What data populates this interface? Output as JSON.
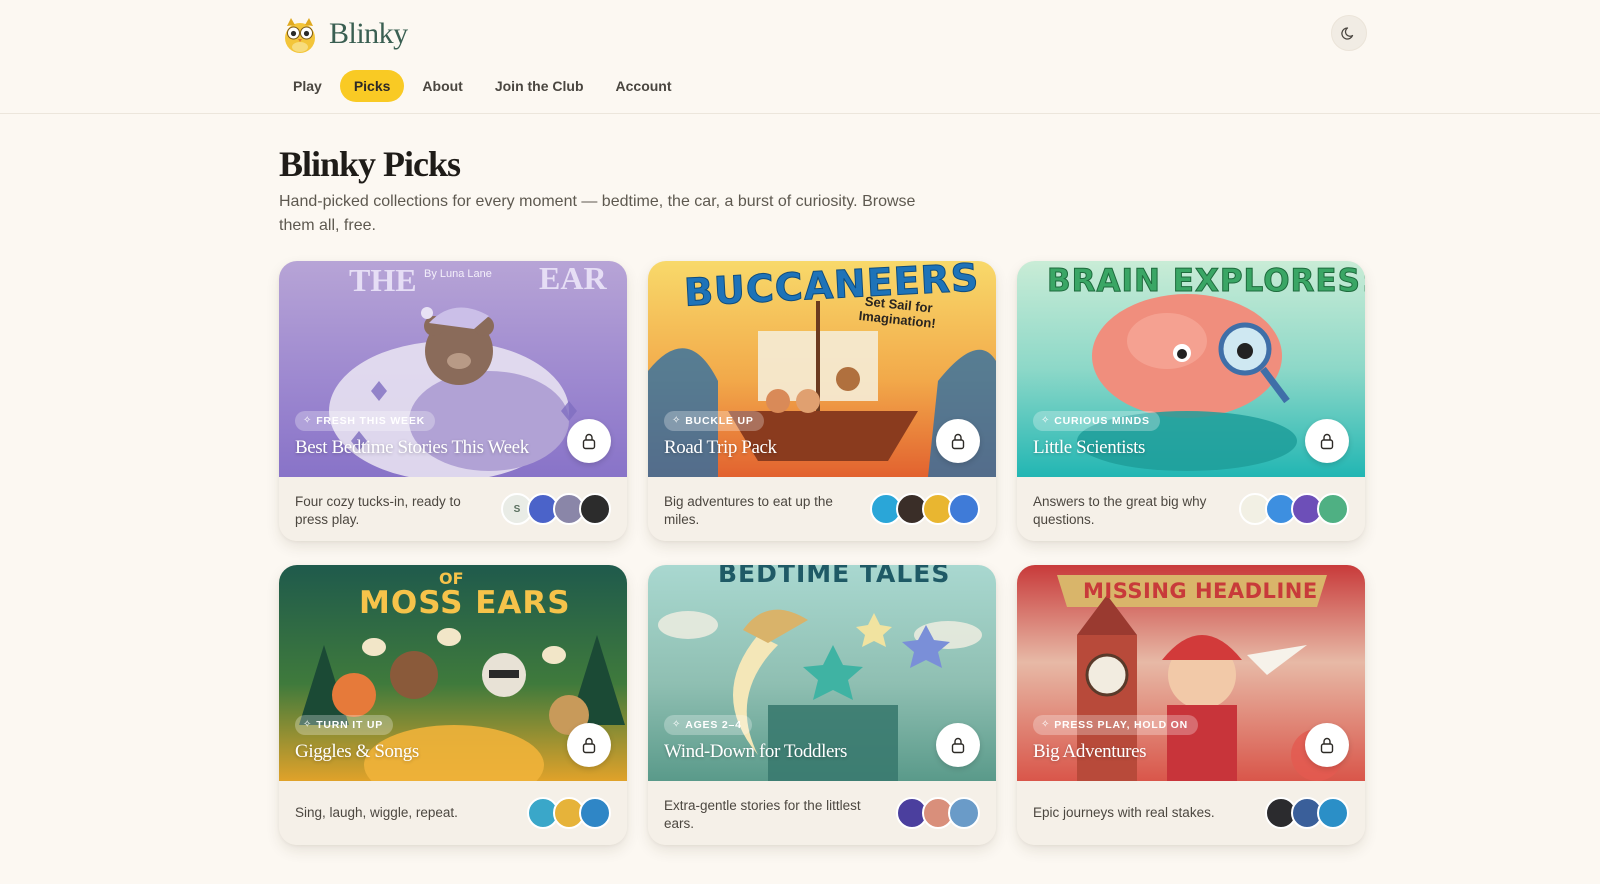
{
  "app": {
    "name": "Blinky"
  },
  "nav": {
    "items": [
      {
        "label": "Play",
        "active": false
      },
      {
        "label": "Picks",
        "active": true
      },
      {
        "label": "About",
        "active": false
      },
      {
        "label": "Join the Club",
        "active": false
      },
      {
        "label": "Account",
        "active": false
      }
    ]
  },
  "page": {
    "title": "Blinky Picks",
    "subtitle": "Hand-picked collections for every moment — bedtime, the car, a burst of curiosity. Browse them all, free."
  },
  "cards": [
    {
      "badge": "FRESH THIS WEEK",
      "title": "Best Bedtime Stories This Week",
      "description": "Four cozy tucks-in, ready to press play.",
      "cover_text": "By Luna Lane",
      "avatar_colors": [
        "#e9ece6",
        "#4b63c9",
        "#8a86a8",
        "#2c2c2c"
      ],
      "avatar_letter": "S"
    },
    {
      "badge": "BUCKLE UP",
      "title": "Road Trip Pack",
      "description": "Big adventures to eat up the miles.",
      "cover_text": "BUCCANEERS",
      "cover_subtext": "Set Sail for Imagination!",
      "avatar_colors": [
        "#2aa6d8",
        "#3a2e28",
        "#e9b630",
        "#3f7bd8"
      ]
    },
    {
      "badge": "CURIOUS MINDS",
      "title": "Little Scientists",
      "description": "Answers to the great big why questions.",
      "cover_text": "BRAIN EXPLORES!",
      "avatar_colors": [
        "#f2f0e4",
        "#3d8fe0",
        "#6d4fb8",
        "#4fb083"
      ]
    },
    {
      "badge": "TURN IT UP",
      "title": "Giggles & Songs",
      "description": "Sing, laugh, wiggle, repeat.",
      "cover_text": "MOSS EARS",
      "cover_subtext": "OF",
      "avatar_colors": [
        "#3aa7c9",
        "#e6b33a",
        "#2f86c6"
      ]
    },
    {
      "badge": "AGES 2–4",
      "title": "Wind-Down for Toddlers",
      "description": "Extra-gentle stories for the littlest ears.",
      "cover_text": "BEDTIME TALES",
      "avatar_colors": [
        "#4b3f9e",
        "#d98f7b",
        "#6a9bc8"
      ]
    },
    {
      "badge": "PRESS PLAY, HOLD ON",
      "title": "Big Adventures",
      "description": "Epic journeys with real stakes.",
      "cover_text": "MISSING HEADLINE",
      "avatar_colors": [
        "#2b2b2e",
        "#3a5f9a",
        "#2b8fc7"
      ]
    }
  ],
  "colors": {
    "accent": "#f9ca24",
    "background": "#fcf8f2",
    "brand_text": "#3a5f52"
  },
  "icons": {
    "theme_toggle": "moon-icon",
    "lock": "lock-icon",
    "badge": "sparkle-icon"
  }
}
